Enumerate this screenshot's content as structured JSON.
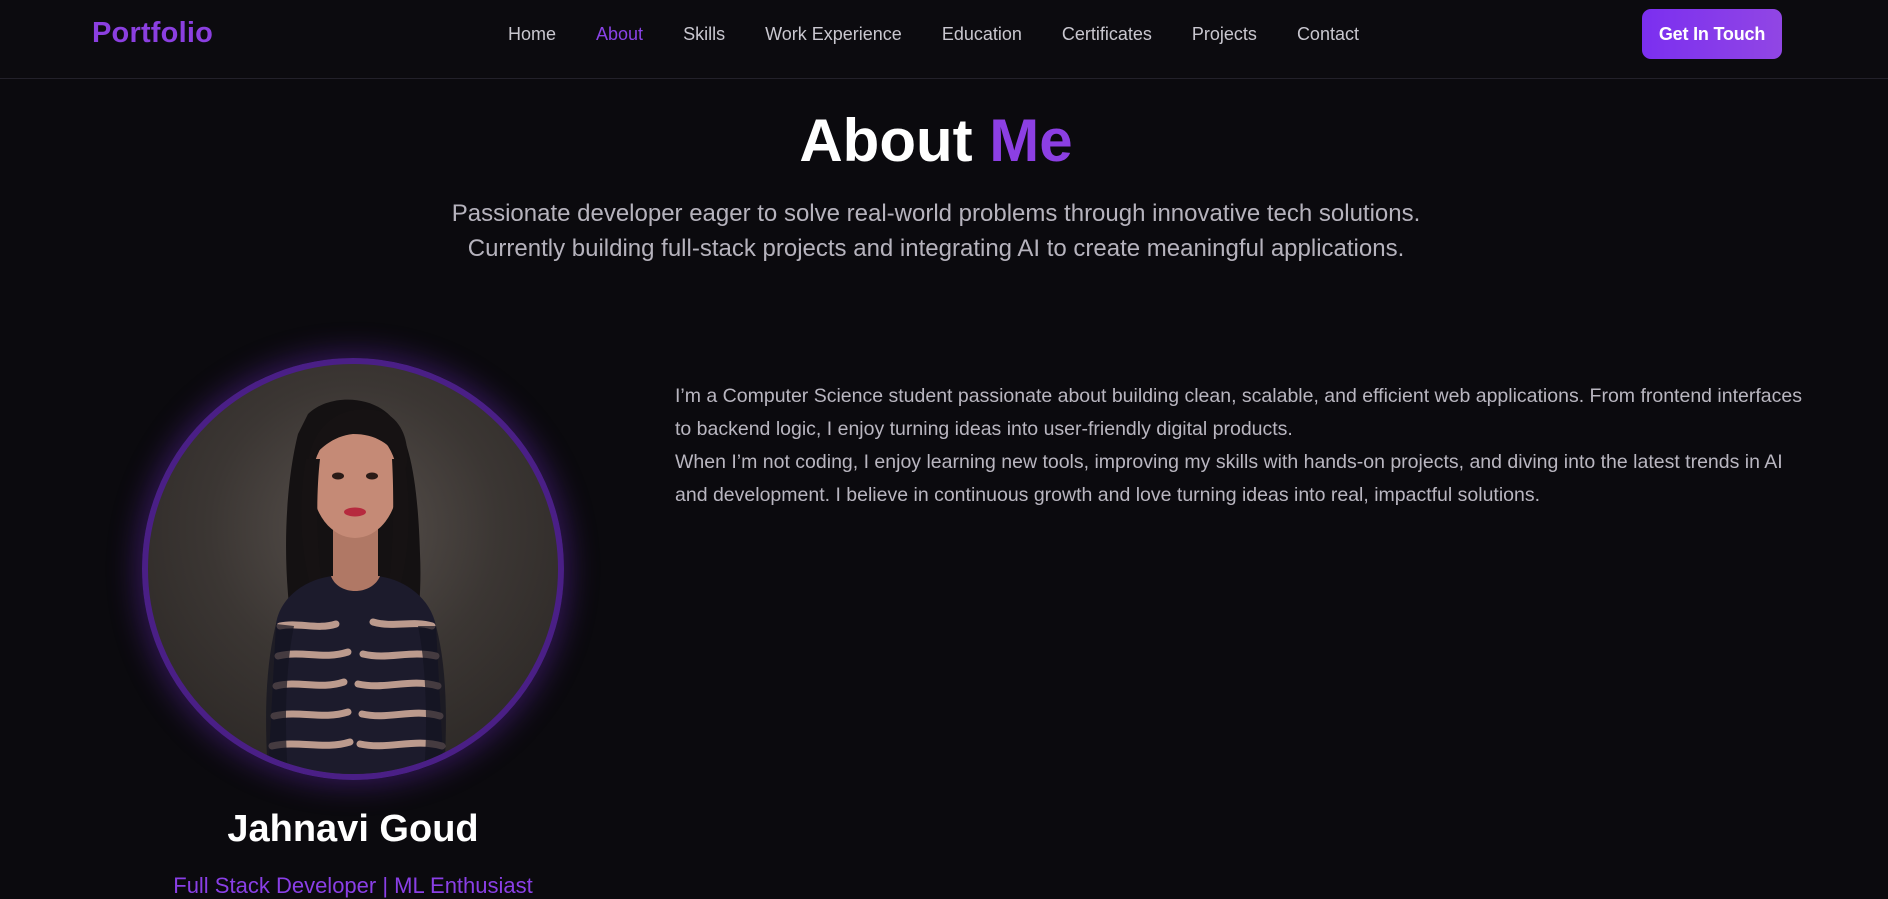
{
  "brand": "Portfolio",
  "nav": {
    "links": [
      "Home",
      "About",
      "Skills",
      "Work Experience",
      "Education",
      "Certificates",
      "Projects",
      "Contact"
    ],
    "active": "About",
    "cta_label": "Get In Touch"
  },
  "about": {
    "title_main": "About",
    "title_accent": "Me",
    "subtitle": "Passionate developer eager to solve real-world problems through innovative tech solutions. Currently building full-stack projects and integrating AI to create meaningful applications.",
    "profile": {
      "name": "Jahnavi Goud",
      "role": "Full Stack Developer | ML Enthusiast"
    },
    "bio": [
      "I’m a Computer Science student passionate about building clean, scalable, and efficient web applications. From frontend interfaces to backend logic, I enjoy turning ideas into user-friendly digital products.",
      "When I’m not coding, I enjoy learning new tools, improving my skills with hands-on projects, and diving into the latest trends in AI and development. I believe in continuous growth and love turning ideas into real, impactful solutions."
    ]
  },
  "colors": {
    "accent": "#8b3fe0",
    "background": "#0b0a0e",
    "cta_gradient_start": "#7b2ff0",
    "cta_gradient_end": "#9146e4"
  }
}
